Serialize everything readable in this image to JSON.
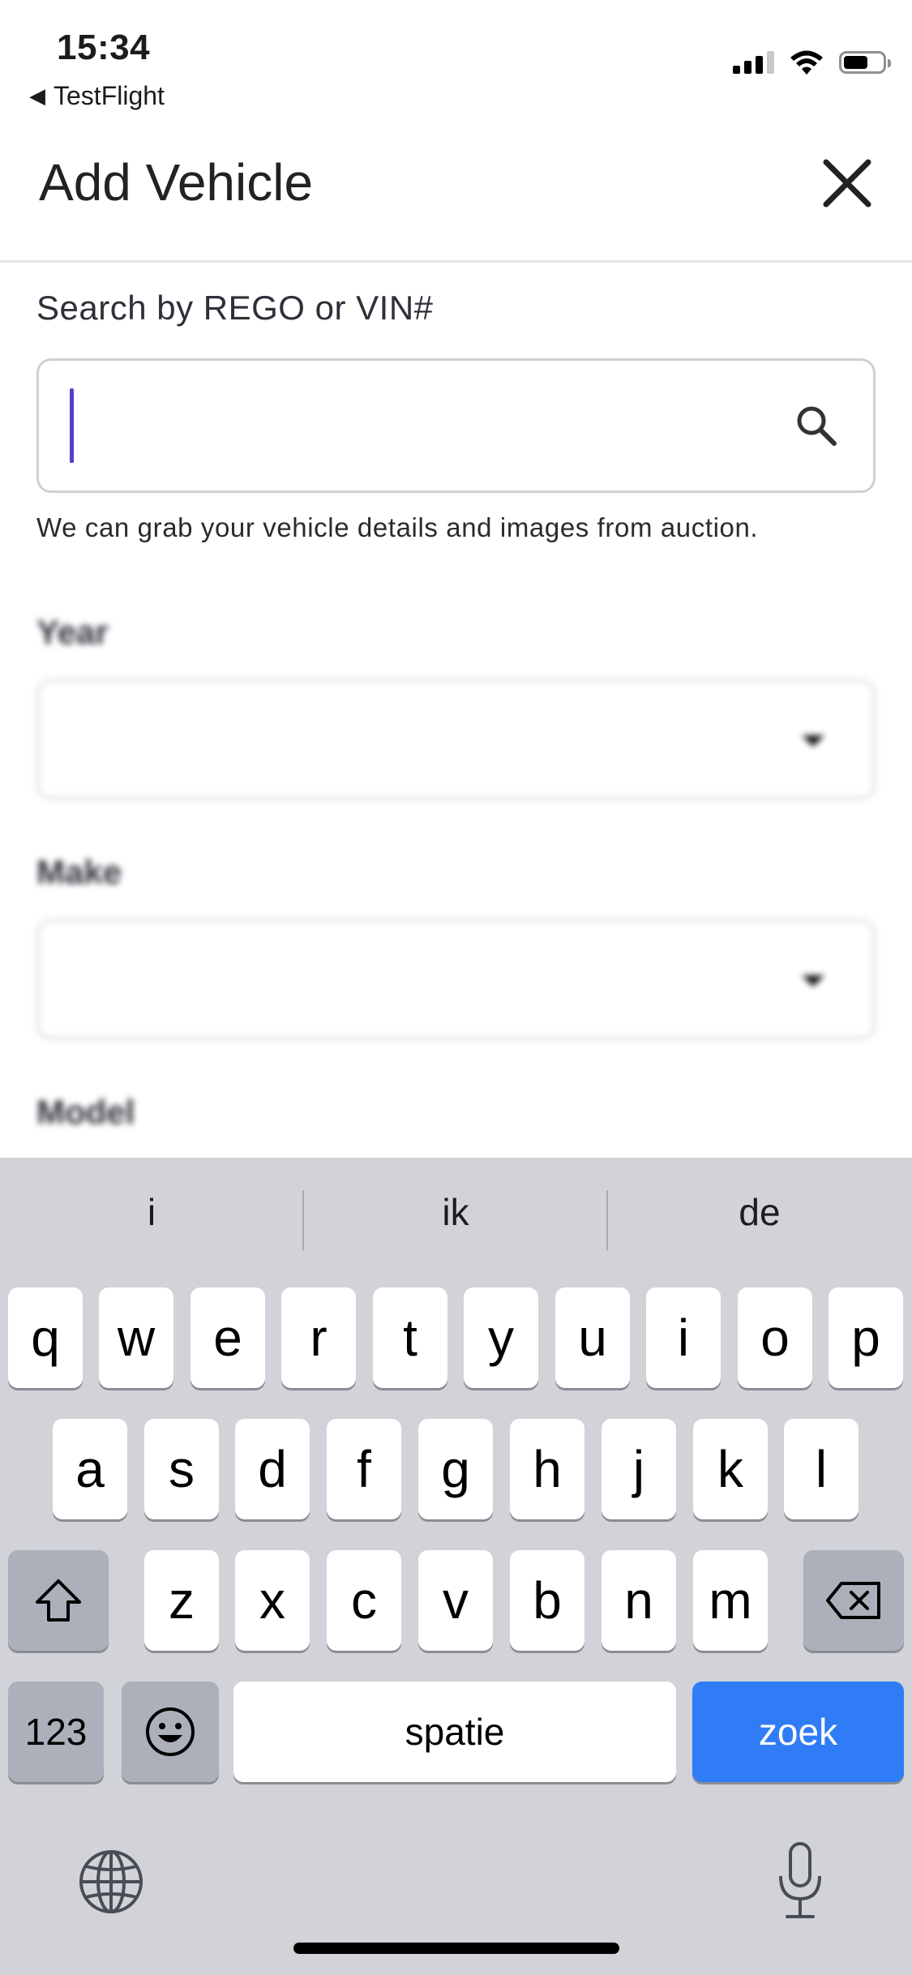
{
  "status_bar": {
    "time": "15:34",
    "back_app": "TestFlight"
  },
  "header": {
    "title": "Add Vehicle"
  },
  "search": {
    "label": "Search by REGO or VIN#",
    "value": "",
    "helper": "We can grab your vehicle details and images from auction."
  },
  "fields": {
    "year_label": "Year",
    "make_label": "Make",
    "model_label": "Model"
  },
  "keyboard": {
    "suggestions": [
      "i",
      "ik",
      "de"
    ],
    "row1": [
      "q",
      "w",
      "e",
      "r",
      "t",
      "y",
      "u",
      "i",
      "o",
      "p"
    ],
    "row2": [
      "a",
      "s",
      "d",
      "f",
      "g",
      "h",
      "j",
      "k",
      "l"
    ],
    "row3": [
      "z",
      "x",
      "c",
      "v",
      "b",
      "n",
      "m"
    ],
    "numbers_key": "123",
    "space_key": "spatie",
    "action_key": "zoek"
  },
  "colors": {
    "caret": "#5a3ec8",
    "action_key": "#2f7cf6",
    "keyboard_bg": "#d1d3d9"
  }
}
